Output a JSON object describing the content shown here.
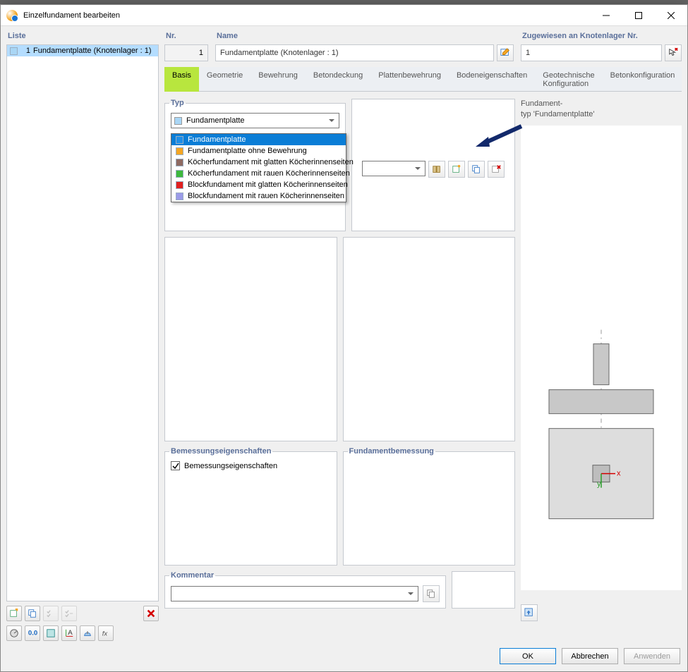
{
  "window": {
    "title": "Einzelfundament bearbeiten"
  },
  "list": {
    "label": "Liste",
    "items": [
      {
        "num": "1",
        "name": "Fundamentplatte (Knotenlager : 1)",
        "color": "#a9d6f5"
      }
    ]
  },
  "nr": {
    "label": "Nr.",
    "value": "1"
  },
  "name": {
    "label": "Name",
    "value": "Fundamentplatte (Knotenlager : 1)"
  },
  "assign": {
    "label": "Zugewiesen an Knotenlager Nr.",
    "value": "1"
  },
  "tabs": [
    "Basis",
    "Geometrie",
    "Bewehrung",
    "Betondeckung",
    "Plattenbewehrung",
    "Bodeneigenschaften",
    "Geotechnische Konfiguration",
    "Betonkonfiguration"
  ],
  "typ": {
    "label": "Typ",
    "selected": "Fundamentplatte",
    "selected_color": "#a9d6f5",
    "options": [
      {
        "label": "Fundamentplatte",
        "color": "#1e8ee7"
      },
      {
        "label": "Fundamentplatte ohne Bewehrung",
        "color": "#f5a623"
      },
      {
        "label": "Köcherfundament mit glatten Köcherinnenseiten",
        "color": "#8e6a62"
      },
      {
        "label": "Köcherfundament mit rauen Köcherinnenseiten",
        "color": "#3eb83e"
      },
      {
        "label": "Blockfundament mit glatten Köcherinnenseiten",
        "color": "#e02020"
      },
      {
        "label": "Blockfundament mit rauen Köcherinnenseiten",
        "color": "#9b9be8"
      }
    ]
  },
  "design": {
    "group1": "Bemessungseigenschaften",
    "group2": "Fundamentbemessung",
    "checkbox": "Bemessungseigenschaften"
  },
  "comment": {
    "label": "Kommentar",
    "value": ""
  },
  "preview": {
    "line1": "Fundament-",
    "line2": "typ 'Fundamentplatte'"
  },
  "buttons": {
    "ok": "OK",
    "cancel": "Abbrechen",
    "apply": "Anwenden"
  }
}
